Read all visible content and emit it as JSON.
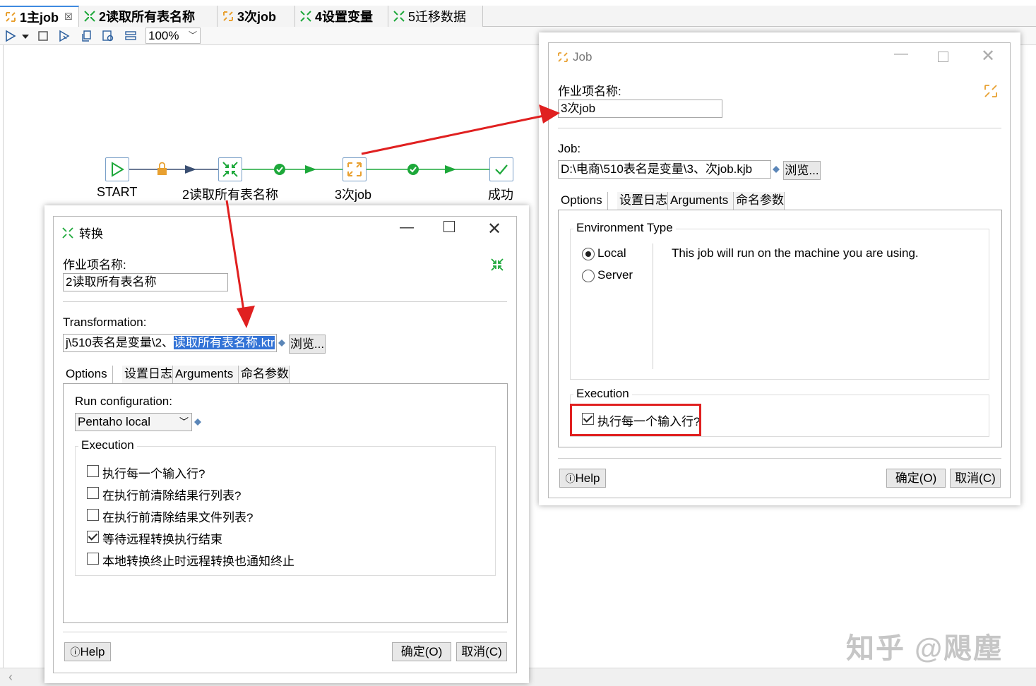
{
  "tabs": [
    {
      "label": "1主job",
      "icon": "job-icon",
      "active": true
    },
    {
      "label": "2读取所有表名称",
      "icon": "transformation-icon",
      "active": false
    },
    {
      "label": "3次job",
      "icon": "job-icon",
      "active": false
    },
    {
      "label": "4设置变量",
      "icon": "transformation-icon",
      "active": false
    },
    {
      "label": "5迁移数据",
      "icon": "transformation-icon",
      "active": false
    }
  ],
  "toolbar": {
    "zoom": "100%"
  },
  "canvas": {
    "nodes": [
      {
        "label": "START",
        "icon": "play-icon"
      },
      {
        "label": "2读取所有表名称",
        "icon": "transformation-icon"
      },
      {
        "label": "3次job",
        "icon": "job-icon"
      },
      {
        "label": "成功",
        "icon": "success-check-icon"
      }
    ]
  },
  "trans_dialog": {
    "title": "转换",
    "name_label": "作业项名称:",
    "name_value": "2读取所有表名称",
    "transformation_label": "Transformation:",
    "path_prefix": "\\510表名是变量\\2、",
    "path_selected": "读取所有表名称.ktr",
    "path_lead": "j",
    "browse": "浏览...",
    "tabs": [
      "Options",
      "设置日志",
      "Arguments",
      "命名参数"
    ],
    "run_config_label": "Run configuration:",
    "run_config_value": "Pentaho local",
    "execution_label": "Execution",
    "options": [
      {
        "label": "执行每一个输入行?",
        "checked": false
      },
      {
        "label": "在执行前清除结果行列表?",
        "checked": false
      },
      {
        "label": "在执行前清除结果文件列表?",
        "checked": false
      },
      {
        "label": "等待远程转换执行结束",
        "checked": true
      },
      {
        "label": "本地转换终止时远程转换也通知终止",
        "checked": false
      }
    ],
    "help": "Help",
    "ok": "确定(O)",
    "cancel": "取消(C)"
  },
  "job_dialog": {
    "title": "Job",
    "name_label": "作业项名称:",
    "name_value": "3次job",
    "job_label": "Job:",
    "job_path": "D:\\电商\\510表名是变量\\3、次job.kjb",
    "browse": "浏览...",
    "tabs": [
      "Options",
      "设置日志",
      "Arguments",
      "命名参数"
    ],
    "env_type_label": "Environment Type",
    "env_local": "Local",
    "env_server": "Server",
    "env_desc": "This job will run on the machine you are using.",
    "execution_label": "Execution",
    "exec_each_row": "执行每一个输入行?",
    "help": "Help",
    "ok": "确定(O)",
    "cancel": "取消(C)"
  },
  "watermark": "知乎 @飓塵",
  "colors": {
    "accent_green": "#1da83a",
    "highlight": "#3373d6",
    "annotation_red": "#e02020",
    "job_orange": "#e8a030"
  }
}
